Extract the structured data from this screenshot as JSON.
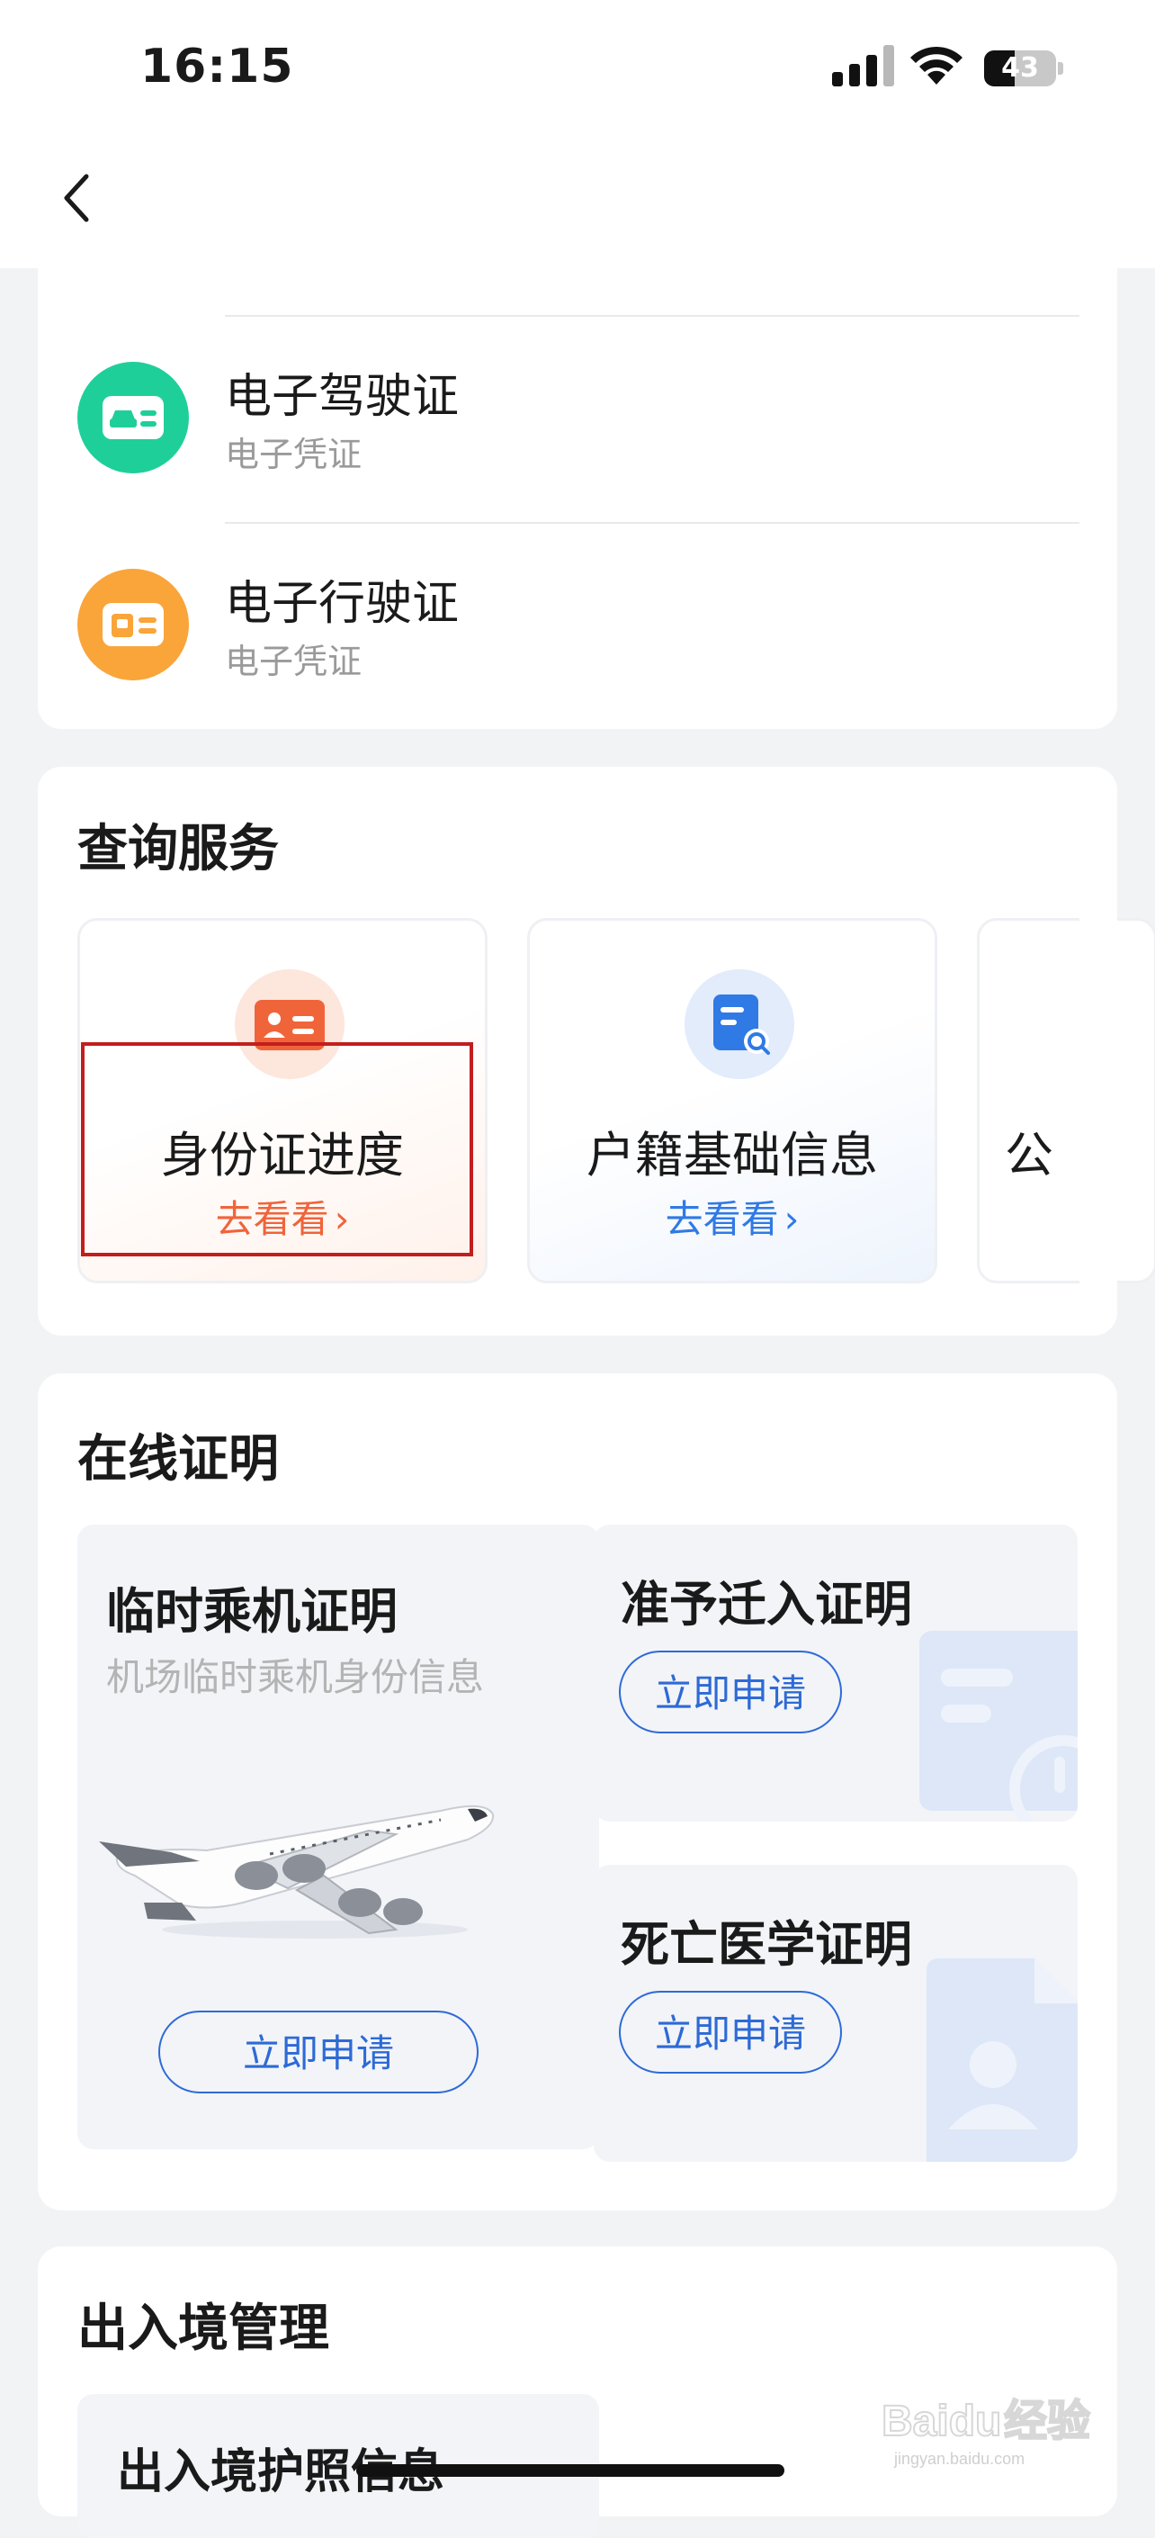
{
  "status_bar": {
    "time": "16:15",
    "battery": "43",
    "battery_level": 0.43
  },
  "licenses": [
    {
      "title": "电子驾驶证",
      "subtitle": "电子凭证",
      "icon": "car-license-icon",
      "color": "#1fcf9a"
    },
    {
      "title": "电子行驶证",
      "subtitle": "电子凭证",
      "icon": "vehicle-license-icon",
      "color": "#f9a53a"
    }
  ],
  "query_services": {
    "title": "查询服务",
    "items": [
      {
        "title": "身份证进度",
        "link": "去看看",
        "icon": "id-card-icon",
        "accent": "#f0643a"
      },
      {
        "title": "户籍基础信息",
        "link": "去看看",
        "icon": "household-search-icon",
        "accent": "#2f7ae5"
      },
      {
        "title": "公"
      }
    ]
  },
  "online_cert": {
    "title": "在线证明",
    "items": [
      {
        "title": "临时乘机证明",
        "subtitle": "机场临时乘机身份信息",
        "button": "立即申请",
        "icon": "airplane-icon"
      },
      {
        "title": "准予迁入证明",
        "button": "立即申请",
        "icon": "document-icon"
      },
      {
        "title": "死亡医学证明",
        "button": "立即申请",
        "icon": "medical-document-icon"
      }
    ]
  },
  "border_mgmt": {
    "title": "出入境管理",
    "items": [
      {
        "title": "出入境护照信息"
      }
    ]
  },
  "watermark": {
    "brand": "Baidu",
    "cn": "经验",
    "url": "jingyan.baidu.com"
  },
  "colors": {
    "primary_blue": "#2d6ad6",
    "highlight_red": "#c21e1e"
  }
}
